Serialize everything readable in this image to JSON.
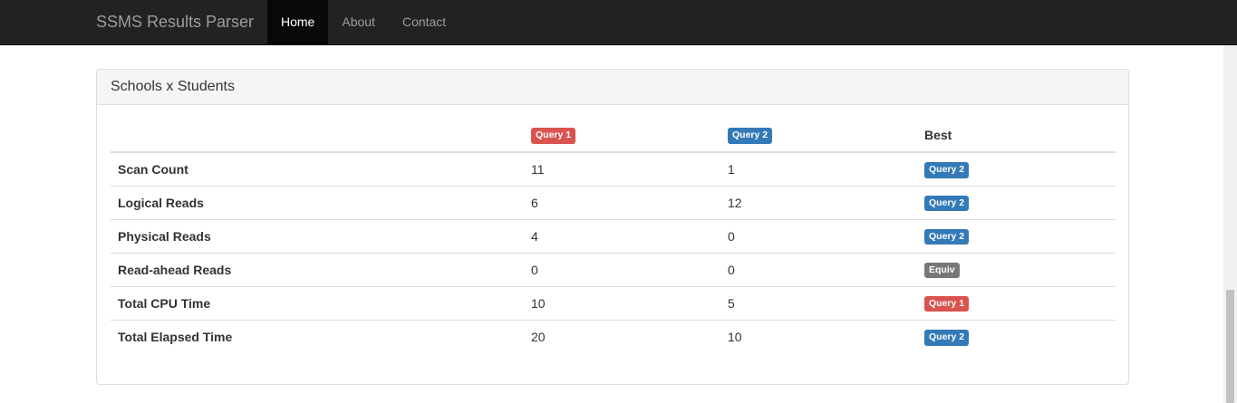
{
  "navbar": {
    "brand": "SSMS Results Parser",
    "links": [
      {
        "label": "Home",
        "active": true
      },
      {
        "label": "About",
        "active": false
      },
      {
        "label": "Contact",
        "active": false
      }
    ]
  },
  "panel": {
    "title": "Schools x Students",
    "headers": {
      "metric": "",
      "query1": "Query 1",
      "query2": "Query 2",
      "best": "Best"
    },
    "rows": [
      {
        "metric": "Scan Count",
        "q1": "11",
        "q2": "1",
        "best": "Query 2",
        "best_style": "primary"
      },
      {
        "metric": "Logical Reads",
        "q1": "6",
        "q2": "12",
        "best": "Query 2",
        "best_style": "primary"
      },
      {
        "metric": "Physical Reads",
        "q1": "4",
        "q2": "0",
        "best": "Query 2",
        "best_style": "primary"
      },
      {
        "metric": "Read-ahead Reads",
        "q1": "0",
        "q2": "0",
        "best": "Equiv",
        "best_style": "default"
      },
      {
        "metric": "Total CPU Time",
        "q1": "10",
        "q2": "5",
        "best": "Query 1",
        "best_style": "danger"
      },
      {
        "metric": "Total Elapsed Time",
        "q1": "20",
        "q2": "10",
        "best": "Query 2",
        "best_style": "primary"
      }
    ]
  },
  "colors": {
    "navbar_bg": "#222222",
    "badge_query1": "#d9534f",
    "badge_query2": "#337ab7",
    "badge_equiv": "#777777"
  }
}
